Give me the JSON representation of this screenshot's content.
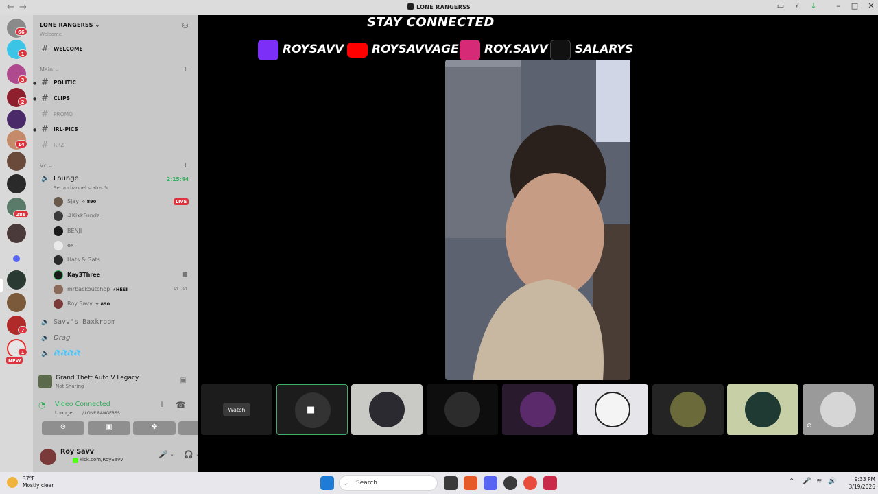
{
  "titlebar": {
    "title": "LONE RANGERSS"
  },
  "rail": {
    "badges": [
      "66",
      "1",
      "3",
      "2",
      "14",
      "288",
      "7",
      "1"
    ],
    "new_label": "NEW"
  },
  "server": {
    "name": "LONE RANGERSS ⌄",
    "partial_top": "Welcome"
  },
  "channels": [
    {
      "name": "WELCOME"
    },
    {
      "name": "POLITIC"
    },
    {
      "name": "CLIPS"
    },
    {
      "name": "PROMO"
    },
    {
      "name": "IRL-PICS"
    },
    {
      "name": "RRZ"
    }
  ],
  "categories": {
    "main": "Main ⌄",
    "vc": "Vc ⌄"
  },
  "lounge": {
    "name": "Lounge",
    "timer": "2:15:44",
    "status_hint": "Set a channel status ✎"
  },
  "users": [
    {
      "name": "Sjay",
      "tag": "✧ 890",
      "live": "LIVE"
    },
    {
      "name": "#KixkFundz"
    },
    {
      "name": "BENJI"
    },
    {
      "name": "ex"
    },
    {
      "name": "Hats & Gats"
    },
    {
      "name": "Kay3Three"
    },
    {
      "name": "mrbackoutchop",
      "tag": "⚡HESI"
    },
    {
      "name": "Roy Savv",
      "tag": "✧ 890"
    }
  ],
  "voice_channels": [
    "Savv's Baxkroom",
    "Drag",
    "💦💦💦💦"
  ],
  "activity": {
    "game": "Grand Theft Auto V Legacy",
    "status": "Not Sharing"
  },
  "vc_panel": {
    "state": "Video Connected",
    "channel": "Lounge",
    "server": "/ LONE RANGERSS"
  },
  "userbar": {
    "name": "Roy Savv",
    "status": "kick.com/RoySavv"
  },
  "overlay": {
    "headline": "STAY CONNECTED",
    "socials": [
      {
        "platform": "twitch-icon",
        "handle": "ROYSAVV",
        "color": "#7b2ff7"
      },
      {
        "platform": "youtube-icon",
        "handle": "ROYSAVVAGE",
        "color": "#ff0000"
      },
      {
        "platform": "instagram-icon",
        "handle": "ROY.SAVV",
        "color": "#d62976"
      },
      {
        "platform": "tiktok-icon",
        "handle": "SALARYS",
        "color": "#111111"
      }
    ]
  },
  "watch_button": "Watch",
  "taskbar": {
    "weather_temp": "37°F",
    "weather_desc": "Mostly clear",
    "search_placeholder": "Search",
    "time": "9:33 PM",
    "date": "3/19/2026"
  }
}
